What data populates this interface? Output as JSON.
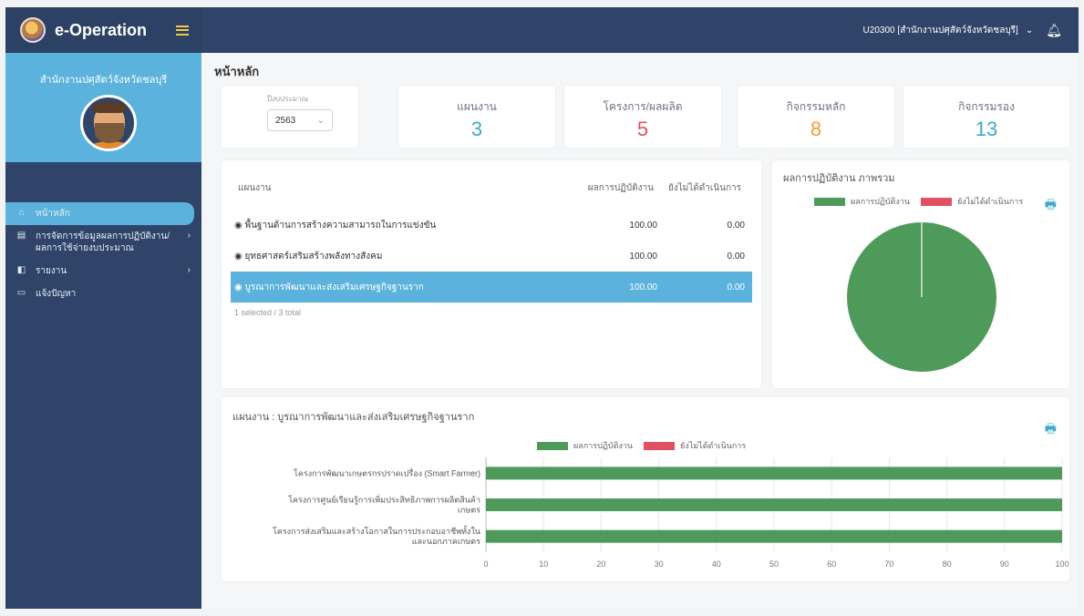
{
  "app": {
    "name": "e-Operation"
  },
  "sidebar": {
    "org": "สำนักงานปศุสัตว์จังหวัดชลบุรี",
    "items": [
      {
        "label": "หน้าหลัก",
        "icon": "home-icon",
        "active": true,
        "chevron": false
      },
      {
        "label": "การจัดการข้อมูลผลการปฏิบัติงาน/ผลการใช้จ่ายงบประมาณ",
        "icon": "database-icon",
        "active": false,
        "chevron": true
      },
      {
        "label": "รายงาน",
        "icon": "report-icon",
        "active": false,
        "chevron": true
      },
      {
        "label": "แจ้งปัญหา",
        "icon": "chat-icon",
        "active": false,
        "chevron": false
      }
    ]
  },
  "topbar": {
    "user": "U20300 [สำนักงานปศุสัตว์จังหวัดชลบุรี]"
  },
  "page": {
    "title": "หน้าหลัก"
  },
  "year": {
    "label": "ปีงบประมาณ",
    "value": "2563"
  },
  "stats": [
    {
      "label": "แผนงาน",
      "value": "3",
      "color": "#3fa9c9"
    },
    {
      "label": "โครงการ/ผลผลิต",
      "value": "5",
      "color": "#e05262"
    },
    {
      "label": "กิจกรรมหลัก",
      "value": "8",
      "color": "#f0a030"
    },
    {
      "label": "กิจกรรมรอง",
      "value": "13",
      "color": "#3fa9c9"
    }
  ],
  "table": {
    "headers": {
      "name": "แผนงาน",
      "result": "ผลการปฏิบัติงาน",
      "pending": "ยังไม่ได้ดำเนินการ"
    },
    "rows": [
      {
        "name": "◉ พื้นฐานด้านการสร้างความสามารถในการแข่งขัน",
        "result": "100.00",
        "pending": "0.00",
        "selected": false
      },
      {
        "name": "◉ ยุทธศาสตร์เสริมสร้างพลังทางสังคม",
        "result": "100.00",
        "pending": "0.00",
        "selected": false
      },
      {
        "name": "◉ บูรณาการพัฒนาและส่งเสริมเศรษฐกิจฐานราก",
        "result": "100.00",
        "pending": "0.00",
        "selected": true
      }
    ],
    "footer": "1 selected / 3 total"
  },
  "pie": {
    "title": "ผลการปฏิบัติงาน ภาพรวม",
    "legend": [
      "ผลการปฏิบัติงาน",
      "ยังไม่ได้ดำเนินการ"
    ]
  },
  "bar": {
    "title": "แผนงาน : บูรณาการพัฒนาและส่งเสริมเศรษฐกิจฐานราก",
    "legend": [
      "ผลการปฏิบัติงาน",
      "ยังไม่ได้ดำเนินการ"
    ]
  },
  "colors": {
    "done": "#4e9a5a",
    "pending": "#e05262",
    "accent": "#5bb3dd",
    "navy": "#2f4468"
  },
  "chart_data": [
    {
      "type": "pie",
      "title": "ผลการปฏิบัติงาน ภาพรวม",
      "series": [
        {
          "name": "ผลการปฏิบัติงาน",
          "value": 100
        },
        {
          "name": "ยังไม่ได้ดำเนินการ",
          "value": 0
        }
      ]
    },
    {
      "type": "bar",
      "orientation": "horizontal",
      "title": "แผนงาน : บูรณาการพัฒนาและส่งเสริมเศรษฐกิจฐานราก",
      "categories": [
        [
          "โครงการพัฒนาเกษตรกรปราดเปรื่อง (Smart Farmer)"
        ],
        [
          "โครงการศูนย์เรียนรู้การเพิ่มประสิทธิภาพการผลิตสินค้า",
          "เกษตร"
        ],
        [
          "โครงการส่งเสริมและสร้างโอกาสในการประกอบอาชีพทั้งใน",
          "และนอกภาคเกษตร"
        ]
      ],
      "series": [
        {
          "name": "ผลการปฏิบัติงาน",
          "values": [
            100,
            100,
            100
          ]
        },
        {
          "name": "ยังไม่ได้ดำเนินการ",
          "values": [
            0,
            0,
            0
          ]
        }
      ],
      "xlim": [
        0,
        100
      ],
      "xticks": [
        0,
        10,
        20,
        30,
        40,
        50,
        60,
        70,
        80,
        90,
        100
      ],
      "legend_position": "top"
    }
  ]
}
